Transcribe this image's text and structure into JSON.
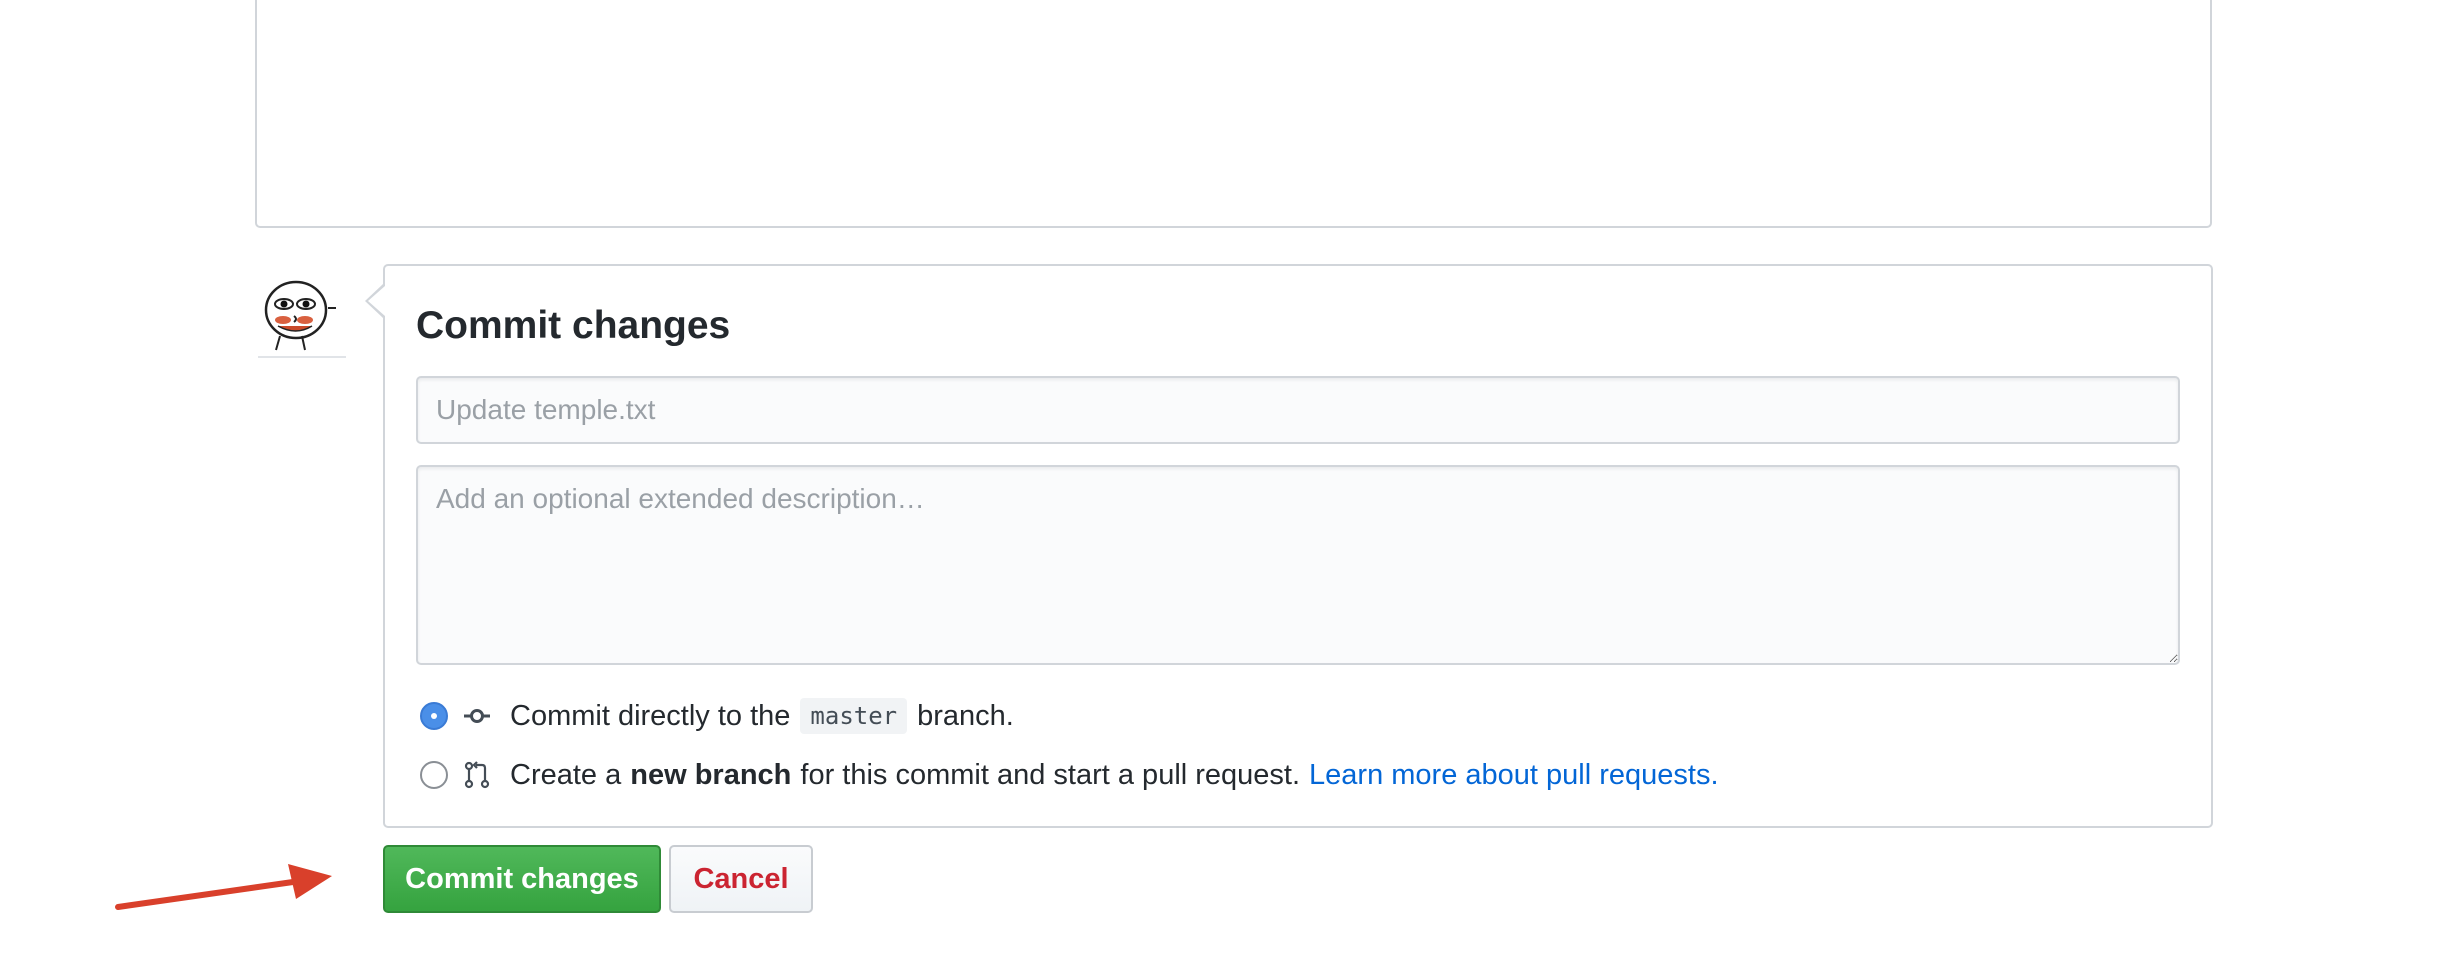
{
  "commit_panel": {
    "title": "Commit changes",
    "summary_placeholder": "Update temple.txt",
    "summary_value": "",
    "description_placeholder": "Add an optional extended description…",
    "description_value": "",
    "options": [
      {
        "selected": true,
        "icon": "git-commit-icon",
        "text_before": "Commit directly to the",
        "branch": "master",
        "text_after": "branch."
      },
      {
        "selected": false,
        "icon": "git-pull-request-icon",
        "text_before": "Create a",
        "bold": "new branch",
        "text_after": "for this commit and start a pull request.",
        "link": "Learn more about pull requests."
      }
    ]
  },
  "actions": {
    "commit_label": "Commit changes",
    "cancel_label": "Cancel"
  },
  "colors": {
    "primary_button": "#3ca845",
    "cancel_text": "#cb2431",
    "link": "#0366d6",
    "radio_selected": "#4a8fe8",
    "annotation_arrow": "#d9402b"
  },
  "annotation": {
    "icon": "red-arrow-icon"
  }
}
